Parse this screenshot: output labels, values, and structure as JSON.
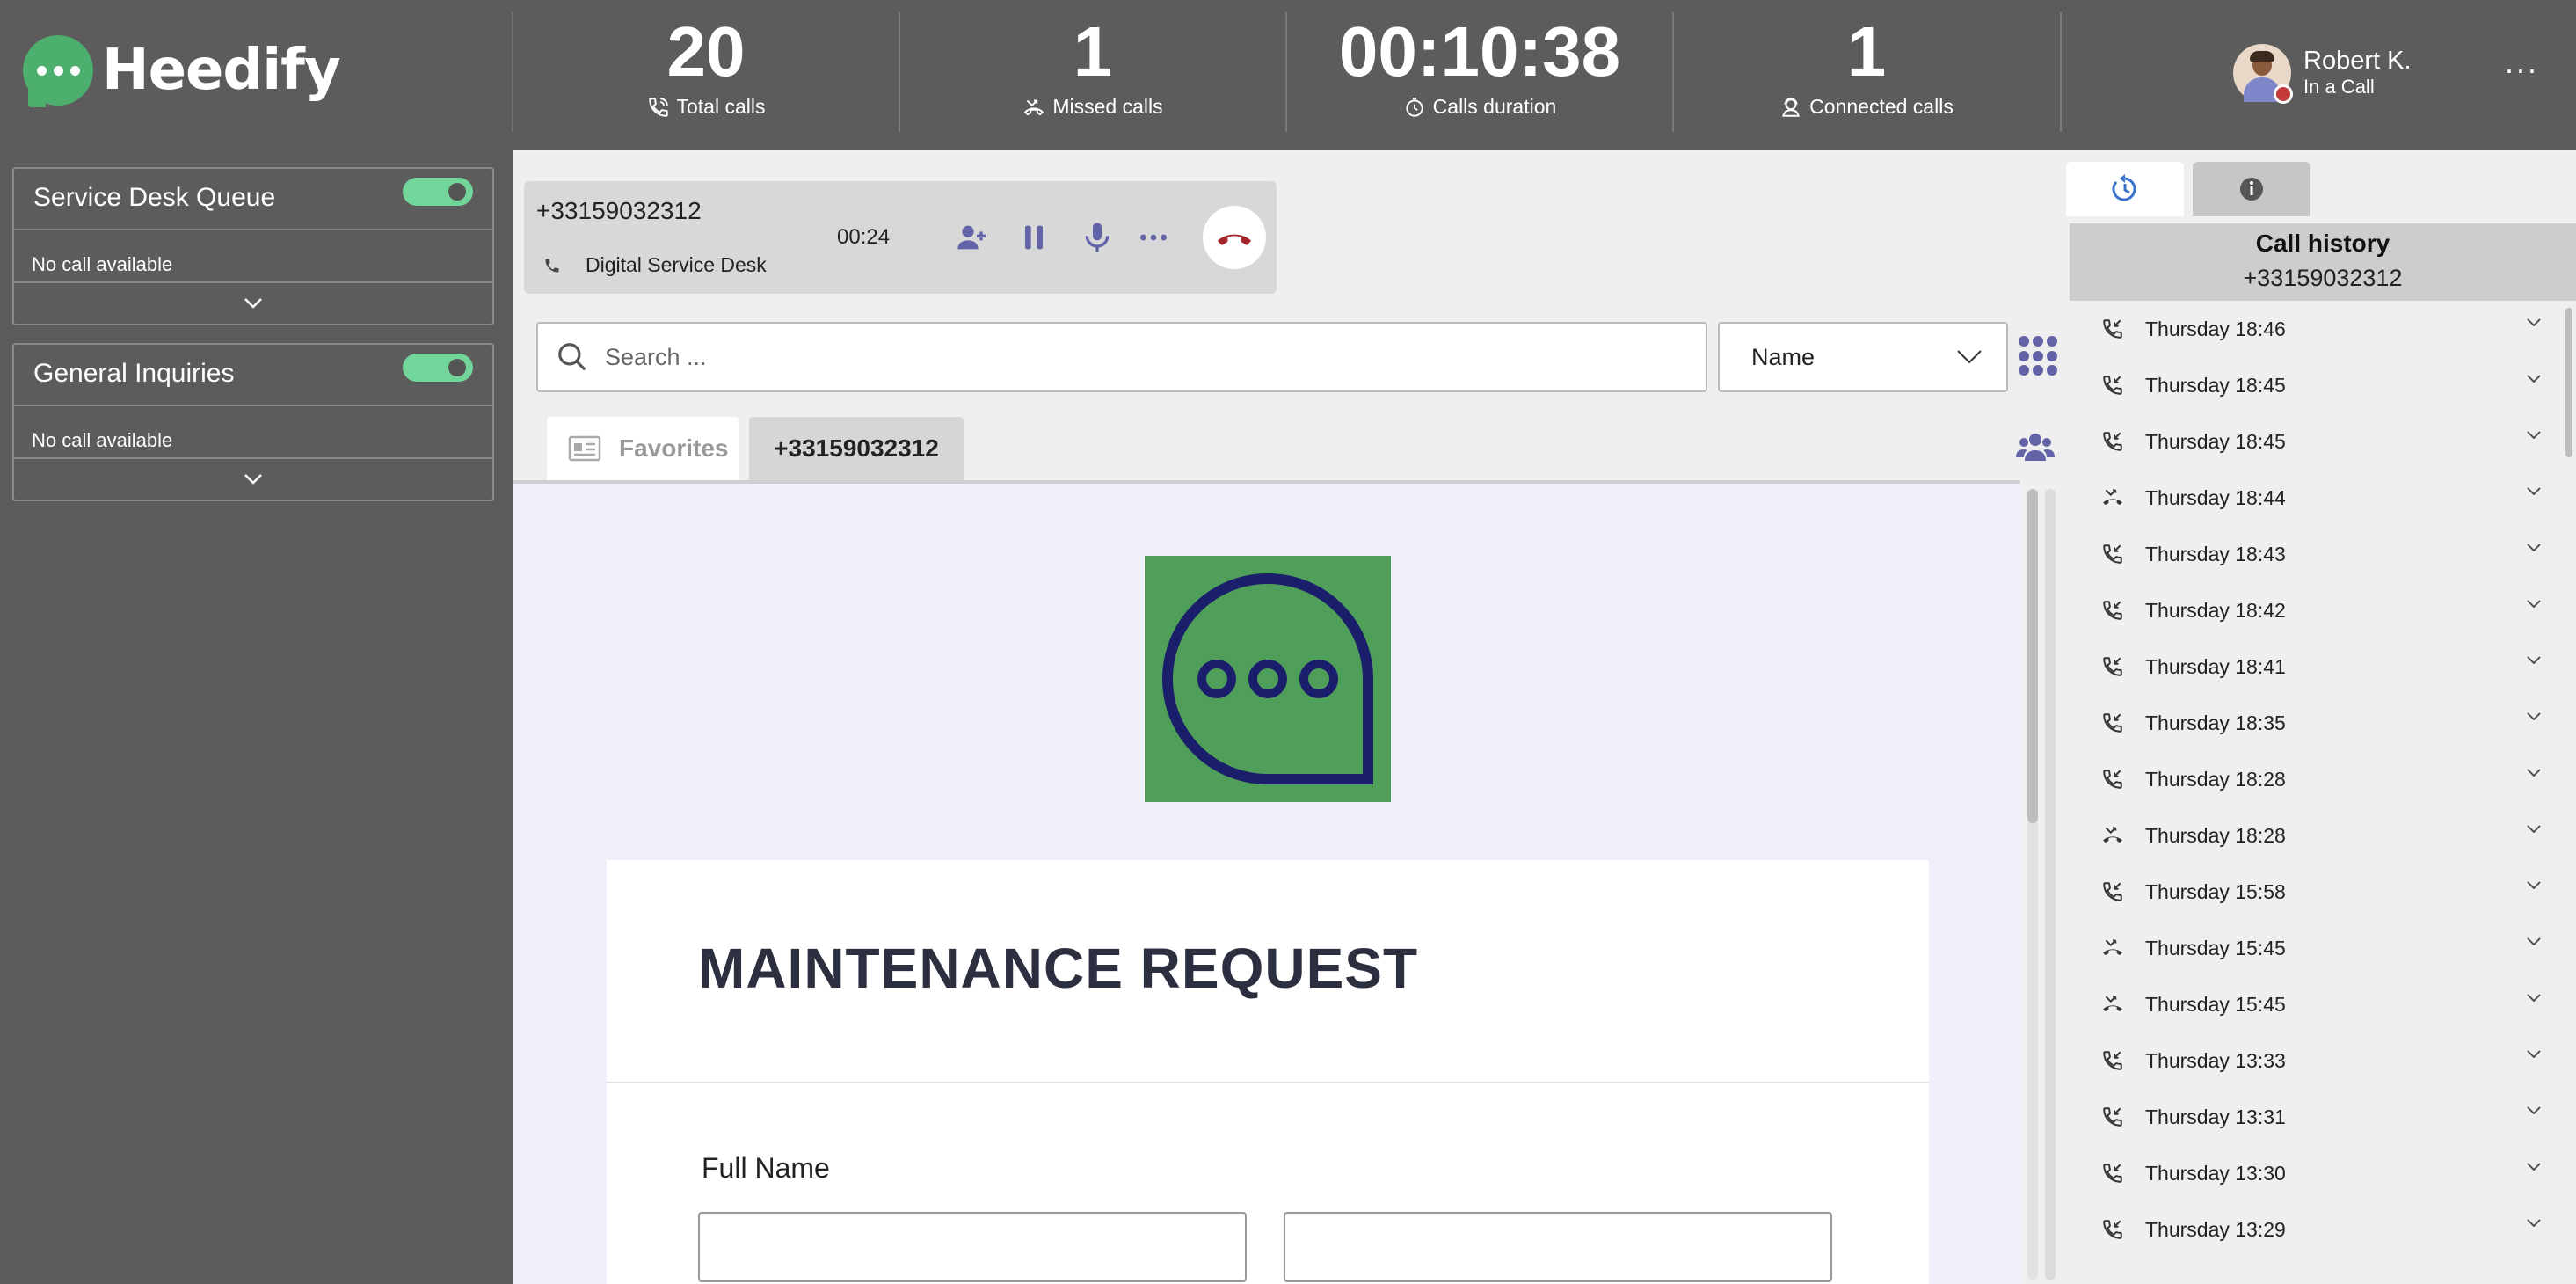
{
  "app": {
    "name": "Heedify"
  },
  "stats": {
    "total_calls": {
      "value": "20",
      "label": "Total calls"
    },
    "missed_calls": {
      "value": "1",
      "label": "Missed calls"
    },
    "calls_duration": {
      "value": "00:10:38",
      "label": "Calls duration"
    },
    "connected_calls": {
      "value": "1",
      "label": "Connected calls"
    }
  },
  "user": {
    "name": "Robert K.",
    "status": "In a Call"
  },
  "queues": [
    {
      "name": "Service Desk Queue",
      "message": "No call available"
    },
    {
      "name": "General Inquiries",
      "message": "No call available"
    }
  ],
  "active_call": {
    "number": "+33159032312",
    "queue": "Digital Service Desk",
    "timer": "00:24"
  },
  "search": {
    "placeholder": "Search ...",
    "sort_value": "Name"
  },
  "tabs": {
    "favorites": "Favorites",
    "contact": "+33159032312"
  },
  "form": {
    "title": "MAINTENANCE REQUEST",
    "full_name_label": "Full Name"
  },
  "history": {
    "title": "Call history",
    "number": "+33159032312",
    "items": [
      {
        "type": "incoming",
        "label": "Thursday 18:46"
      },
      {
        "type": "incoming",
        "label": "Thursday 18:45"
      },
      {
        "type": "incoming",
        "label": "Thursday 18:45"
      },
      {
        "type": "missed",
        "label": "Thursday 18:44"
      },
      {
        "type": "incoming",
        "label": "Thursday 18:43"
      },
      {
        "type": "incoming",
        "label": "Thursday 18:42"
      },
      {
        "type": "incoming",
        "label": "Thursday 18:41"
      },
      {
        "type": "incoming",
        "label": "Thursday 18:35"
      },
      {
        "type": "incoming",
        "label": "Thursday 18:28"
      },
      {
        "type": "missed",
        "label": "Thursday 18:28"
      },
      {
        "type": "incoming",
        "label": "Thursday 15:58"
      },
      {
        "type": "missed",
        "label": "Thursday 15:45"
      },
      {
        "type": "missed",
        "label": "Thursday 15:45"
      },
      {
        "type": "incoming",
        "label": "Thursday 13:33"
      },
      {
        "type": "incoming",
        "label": "Thursday 13:31"
      },
      {
        "type": "incoming",
        "label": "Thursday 13:30"
      },
      {
        "type": "incoming",
        "label": "Thursday 13:29"
      }
    ]
  },
  "colors": {
    "brand_green": "#4caf6e",
    "accent_purple": "#6264a7",
    "hangup_red": "#a4262c",
    "toggle_on": "#72d69b",
    "top_bar": "#5c5c5c",
    "form_navy": "#1b1f6b"
  },
  "icons": {
    "total_calls": "phone-icon",
    "missed_calls": "missed-call-icon",
    "calls_duration": "timer-icon",
    "connected_calls": "headset-icon",
    "more": "more-horizontal-icon",
    "add_person": "add-person-icon",
    "hold": "pause-icon",
    "mute": "microphone-icon",
    "hangup": "hang-up-icon",
    "search": "search-icon",
    "dialpad": "dialpad-icon",
    "contacts": "people-icon",
    "history_tab": "history-icon",
    "info_tab": "info-icon"
  }
}
